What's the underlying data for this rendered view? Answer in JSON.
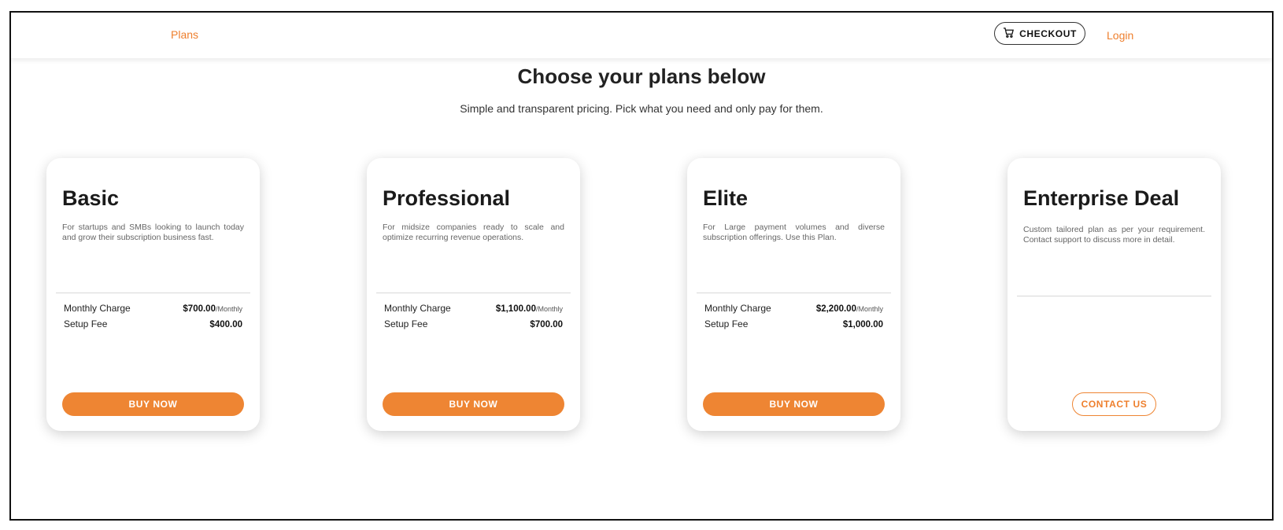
{
  "nav": {
    "plans": "Plans",
    "checkout": "CHECKOUT",
    "login": "Login"
  },
  "header": {
    "title": "Choose your plans below",
    "subtitle": "Simple and transparent pricing. Pick what you need and only pay for them."
  },
  "plans": [
    {
      "name": "Basic",
      "description": "For startups and SMBs looking to launch today and grow their subscription business fast.",
      "monthly_label": "Monthly Charge",
      "monthly_amount": "$700.00",
      "monthly_unit": "/Monthly",
      "setup_label": "Setup Fee",
      "setup_amount": "$400.00",
      "button": "BUY NOW"
    },
    {
      "name": "Professional",
      "description": "For midsize companies ready to scale and optimize recurring revenue operations.",
      "monthly_label": "Monthly Charge",
      "monthly_amount": "$1,100.00",
      "monthly_unit": "/Monthly",
      "setup_label": "Setup Fee",
      "setup_amount": "$700.00",
      "button": "BUY NOW"
    },
    {
      "name": "Elite",
      "description": "For Large payment volumes and diverse subscription offerings. Use this Plan.",
      "monthly_label": "Monthly Charge",
      "monthly_amount": "$2,200.00",
      "monthly_unit": "/Monthly",
      "setup_label": "Setup Fee",
      "setup_amount": "$1,000.00",
      "button": "BUY NOW"
    },
    {
      "name": "Enterprise Deal",
      "description": "Custom tailored plan as per your requirement. Contact support to discuss more in detail.",
      "button": "CONTACT US"
    }
  ],
  "colors": {
    "accent": "#ee8533",
    "text": "#222222",
    "muted": "#666666"
  },
  "icons": {
    "checkout": "cart-icon"
  }
}
